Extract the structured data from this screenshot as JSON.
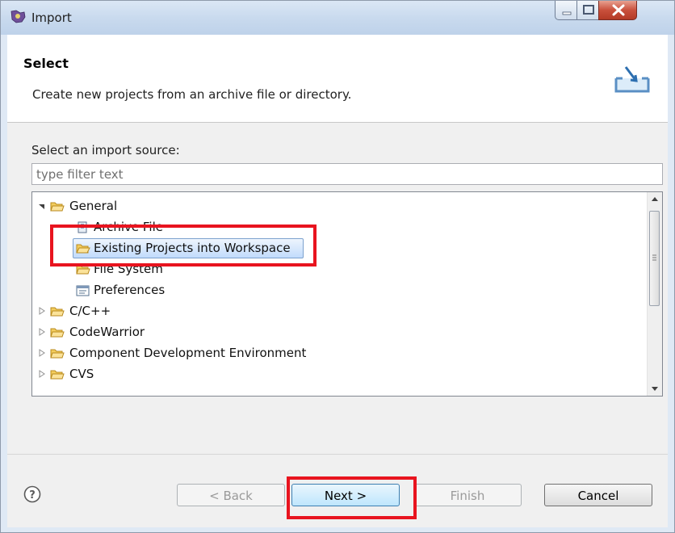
{
  "window": {
    "title": "Import",
    "controls": [
      "minimize-icon",
      "maximize-icon",
      "close-icon"
    ]
  },
  "banner": {
    "title": "Select",
    "description": "Create new projects from an archive file or directory.",
    "icon": "import-wizard-icon"
  },
  "source": {
    "label": "Select an import source:",
    "filter_placeholder": "type filter text",
    "filter_value": ""
  },
  "tree": {
    "items": [
      {
        "label": "General",
        "expanded": true,
        "icon": "folder-icon"
      },
      {
        "label": "Archive File",
        "icon": "archive-file-icon"
      },
      {
        "label": "Existing Projects into Workspace",
        "icon": "folder-open-icon",
        "selected": true
      },
      {
        "label": "File System",
        "icon": "folder-icon"
      },
      {
        "label": "Preferences",
        "icon": "preferences-icon"
      },
      {
        "label": "C/C++",
        "expanded": false,
        "icon": "folder-icon"
      },
      {
        "label": "CodeWarrior",
        "expanded": false,
        "icon": "folder-icon"
      },
      {
        "label": "Component Development Environment",
        "expanded": false,
        "icon": "folder-icon"
      },
      {
        "label": "CVS",
        "expanded": false,
        "icon": "folder-icon"
      }
    ]
  },
  "footer": {
    "help_icon": "help-icon",
    "back": "< Back",
    "next": "Next >",
    "finish": "Finish",
    "cancel": "Cancel"
  },
  "colors": {
    "highlight_box": "#e8141f",
    "selection": "#c1dbfc",
    "folder": "#e8b83a"
  }
}
